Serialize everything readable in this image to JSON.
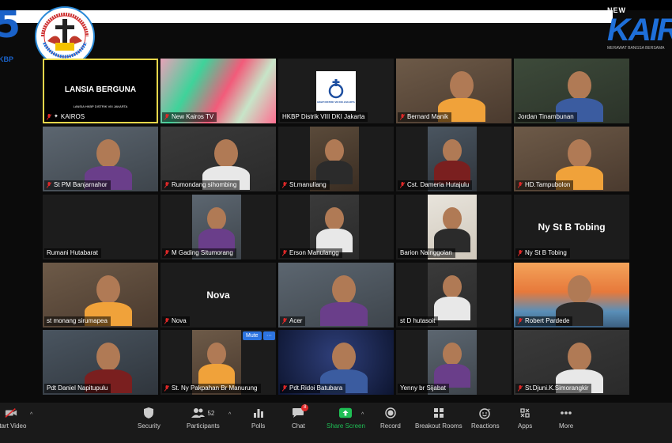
{
  "branding": {
    "left_logo_text": "KBP",
    "badge_text": "HKBP DISTRIK VIII JAKARTA",
    "right_logo_top": "NEW",
    "right_logo_main": "KAIRO",
    "right_logo_sub": "MERAWAT BANGSA BERSAMA"
  },
  "tiles": [
    {
      "name": "KAIROS",
      "title": "LANSIA BERGUNA",
      "subtitle": "LANSIA HKBP DISTRIK VIII JAKARTA",
      "type": "slide"
    },
    {
      "name": "New Kairos TV",
      "type": "abstract"
    },
    {
      "name": "HKBP Distrik VIII DKI Jakarta",
      "logo_text": "HKBP DISTRIK VIII DKI JAKARTA",
      "type": "logo"
    },
    {
      "name": "Bernard Manik",
      "type": "video"
    },
    {
      "name": "Jordan Tinambunan",
      "type": "video"
    },
    {
      "name": "St PM Banjarnahor",
      "type": "video"
    },
    {
      "name": "Rumondang sihombing",
      "type": "video"
    },
    {
      "name": "St.manullang",
      "type": "video"
    },
    {
      "name": "Cst. Dameria Hutajulu",
      "type": "video"
    },
    {
      "name": "HD.Tampubolon",
      "type": "video"
    },
    {
      "name": "Rumani Hutabarat",
      "type": "blank"
    },
    {
      "name": "M Gading Situmorang",
      "type": "video"
    },
    {
      "name": "Erson Manulangg",
      "type": "video"
    },
    {
      "name": "Barion Nainggolan",
      "type": "photo"
    },
    {
      "name": "Ny St B Tobing",
      "big": "Ny St B Tobing",
      "type": "nameonly"
    },
    {
      "name": "st monang sirumapea",
      "type": "video"
    },
    {
      "name": "Nova",
      "big": "Nova",
      "type": "nameonly"
    },
    {
      "name": "Acer",
      "type": "video"
    },
    {
      "name": "st D hutasoit",
      "type": "video"
    },
    {
      "name": "Robert Pardede",
      "type": "video"
    },
    {
      "name": "Pdt Daniel Napitupulu",
      "type": "video"
    },
    {
      "name": "St. Ny Pakpahan Br Manurung",
      "type": "video"
    },
    {
      "name": "Pdt.Ridoi Batubara",
      "type": "video"
    },
    {
      "name": "Yenny br Sijabat",
      "type": "video"
    },
    {
      "name": "St.Djuni.K.Simorangkir",
      "type": "video"
    }
  ],
  "hover_controls": {
    "mute": "Mute",
    "more": "···"
  },
  "toolbar": {
    "start_video": "Start Video",
    "security": "Security",
    "participants": "Participants",
    "participants_count": "52",
    "polls": "Polls",
    "chat": "Chat",
    "chat_badge": "8",
    "share_screen": "Share Screen",
    "record": "Record",
    "breakout_rooms": "Breakout Rooms",
    "reactions": "Reactions",
    "apps": "Apps",
    "more": "More"
  },
  "colors": {
    "selected_border": "#e6d64a",
    "share_green": "#1fbf55",
    "brand_blue": "#1e6fd9",
    "muted_red": "#e02828"
  }
}
